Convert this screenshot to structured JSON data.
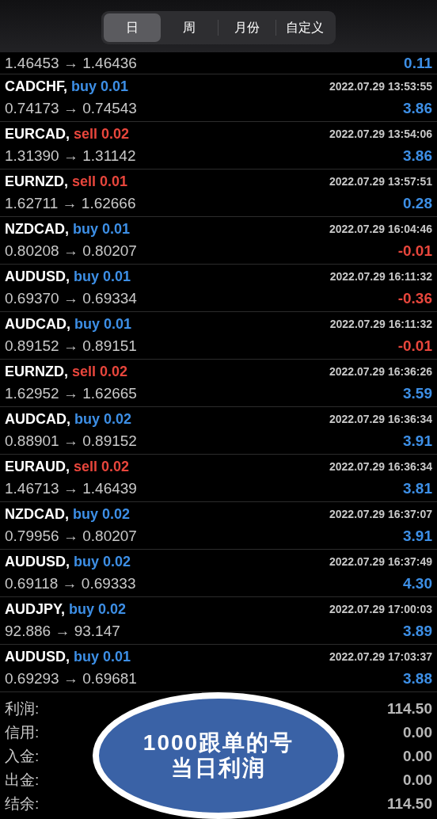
{
  "period_tabs": [
    {
      "label": "日",
      "selected": true
    },
    {
      "label": "周",
      "selected": false
    },
    {
      "label": "月份",
      "selected": false
    },
    {
      "label": "自定义",
      "selected": false
    }
  ],
  "partial_row": {
    "prices": "1.46453 → 1.46436",
    "profit": "0.11",
    "loss": false
  },
  "trades": [
    {
      "symbol": "CADCHF,",
      "direction": "buy",
      "lots": "0.01",
      "time": "2022.07.29 13:53:55",
      "prices": "0.74173 → 0.74543",
      "profit": "3.86",
      "loss": false
    },
    {
      "symbol": "EURCAD,",
      "direction": "sell",
      "lots": "0.02",
      "time": "2022.07.29 13:54:06",
      "prices": "1.31390 → 1.31142",
      "profit": "3.86",
      "loss": false
    },
    {
      "symbol": "EURNZD,",
      "direction": "sell",
      "lots": "0.01",
      "time": "2022.07.29 13:57:51",
      "prices": "1.62711 → 1.62666",
      "profit": "0.28",
      "loss": false
    },
    {
      "symbol": "NZDCAD,",
      "direction": "buy",
      "lots": "0.01",
      "time": "2022.07.29 16:04:46",
      "prices": "0.80208 → 0.80207",
      "profit": "-0.01",
      "loss": true
    },
    {
      "symbol": "AUDUSD,",
      "direction": "buy",
      "lots": "0.01",
      "time": "2022.07.29 16:11:32",
      "prices": "0.69370 → 0.69334",
      "profit": "-0.36",
      "loss": true
    },
    {
      "symbol": "AUDCAD,",
      "direction": "buy",
      "lots": "0.01",
      "time": "2022.07.29 16:11:32",
      "prices": "0.89152 → 0.89151",
      "profit": "-0.01",
      "loss": true
    },
    {
      "symbol": "EURNZD,",
      "direction": "sell",
      "lots": "0.02",
      "time": "2022.07.29 16:36:26",
      "prices": "1.62952 → 1.62665",
      "profit": "3.59",
      "loss": false
    },
    {
      "symbol": "AUDCAD,",
      "direction": "buy",
      "lots": "0.02",
      "time": "2022.07.29 16:36:34",
      "prices": "0.88901 → 0.89152",
      "profit": "3.91",
      "loss": false
    },
    {
      "symbol": "EURAUD,",
      "direction": "sell",
      "lots": "0.02",
      "time": "2022.07.29 16:36:34",
      "prices": "1.46713 → 1.46439",
      "profit": "3.81",
      "loss": false
    },
    {
      "symbol": "NZDCAD,",
      "direction": "buy",
      "lots": "0.02",
      "time": "2022.07.29 16:37:07",
      "prices": "0.79956 → 0.80207",
      "profit": "3.91",
      "loss": false
    },
    {
      "symbol": "AUDUSD,",
      "direction": "buy",
      "lots": "0.02",
      "time": "2022.07.29 16:37:49",
      "prices": "0.69118 → 0.69333",
      "profit": "4.30",
      "loss": false
    },
    {
      "symbol": "AUDJPY,",
      "direction": "buy",
      "lots": "0.02",
      "time": "2022.07.29 17:00:03",
      "prices": "92.886 → 93.147",
      "profit": "3.89",
      "loss": false
    },
    {
      "symbol": "AUDUSD,",
      "direction": "buy",
      "lots": "0.01",
      "time": "2022.07.29 17:03:37",
      "prices": "0.69293 → 0.69681",
      "profit": "3.88",
      "loss": false
    }
  ],
  "summary": [
    {
      "label": "利润:",
      "value": "114.50"
    },
    {
      "label": "信用:",
      "value": "0.00"
    },
    {
      "label": "入金:",
      "value": "0.00"
    },
    {
      "label": "出金:",
      "value": "0.00"
    },
    {
      "label": "结余:",
      "value": "114.50"
    }
  ],
  "callout": {
    "lines": [
      "1000跟单的号",
      "当日利润"
    ]
  }
}
